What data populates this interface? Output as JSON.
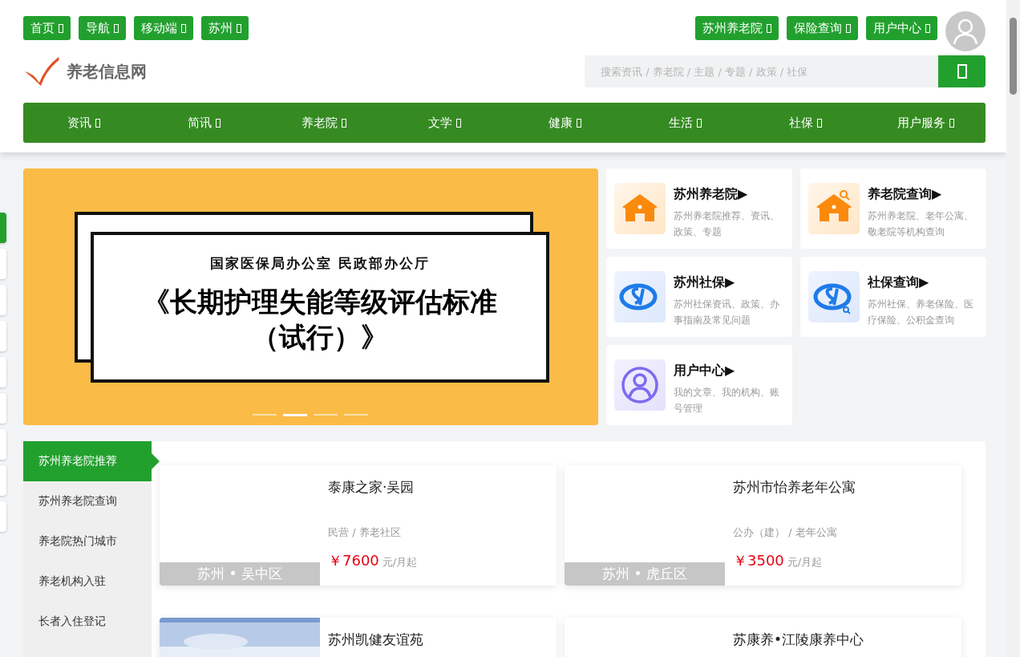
{
  "top_links_left": [
    {
      "label": "首页"
    },
    {
      "label": "导航"
    },
    {
      "label": "移动端"
    },
    {
      "label": "苏州"
    }
  ],
  "top_links_right": [
    {
      "label": "苏州养老院"
    },
    {
      "label": "保险查询"
    },
    {
      "label": "用户中心"
    }
  ],
  "logo": {
    "name": "养老信息网"
  },
  "search": {
    "placeholder": "搜索资讯 / 养老院 / 主题 / 专题 / 政策 / 社保"
  },
  "nav": [
    {
      "label": "资讯"
    },
    {
      "label": "简讯"
    },
    {
      "label": "养老院"
    },
    {
      "label": "文学"
    },
    {
      "label": "健康"
    },
    {
      "label": "生活"
    },
    {
      "label": "社保"
    },
    {
      "label": "用户服务"
    }
  ],
  "side_tabs": [
    {
      "selected": true
    },
    {
      "selected": false
    },
    {
      "selected": false
    },
    {
      "selected": false
    },
    {
      "selected": false
    },
    {
      "selected": false
    },
    {
      "selected": false
    },
    {
      "selected": false
    },
    {
      "selected": false
    }
  ],
  "banner": {
    "kicker": "国家医保局办公室 民政部办公厅",
    "title": "《长期护理失能等级评估标准（试行）》",
    "dots": [
      {
        "selected": false
      },
      {
        "selected": true
      },
      {
        "selected": false
      },
      {
        "selected": false
      }
    ]
  },
  "quick_links": [
    {
      "kind": "home",
      "title": "苏州养老院▶",
      "desc": "苏州养老院推荐、资讯、政策、专题"
    },
    {
      "kind": "home-search",
      "title": "养老院查询▶",
      "desc": "苏州养老院、老年公寓、敬老院等机构查询"
    },
    {
      "kind": "si",
      "title": "苏州社保▶",
      "desc": "苏州社保资讯、政策、办事指南及常见问题"
    },
    {
      "kind": "si-search",
      "title": "社保查询▶",
      "desc": "苏州社保、养老保险、医疗保险、公积金查询"
    },
    {
      "kind": "user",
      "title": "用户中心▶",
      "desc": "我的文章、我的机构、账号管理"
    }
  ],
  "menu": [
    {
      "label": "苏州养老院推荐",
      "selected": true
    },
    {
      "label": "苏州养老院查询",
      "selected": false
    },
    {
      "label": "养老院热门城市",
      "selected": false
    },
    {
      "label": "养老机构入驻",
      "selected": false
    },
    {
      "label": "长者入住登记",
      "selected": false
    }
  ],
  "listings": [
    {
      "name": "泰康之家·吴园",
      "location": "苏州 • 吴中区",
      "type": "民营 / 养老社区",
      "price": "￥7600",
      "unit": "元/月起",
      "photo": false
    },
    {
      "name": "苏州市怡养老年公寓",
      "location": "苏州 • 虎丘区",
      "type": "公办（建） / 老年公寓",
      "price": "￥3500",
      "unit": "元/月起",
      "photo": false
    },
    {
      "name": "苏州凯健友谊苑",
      "photo": true
    },
    {
      "name": "苏康养•江陵康养中心",
      "photo": false
    }
  ]
}
